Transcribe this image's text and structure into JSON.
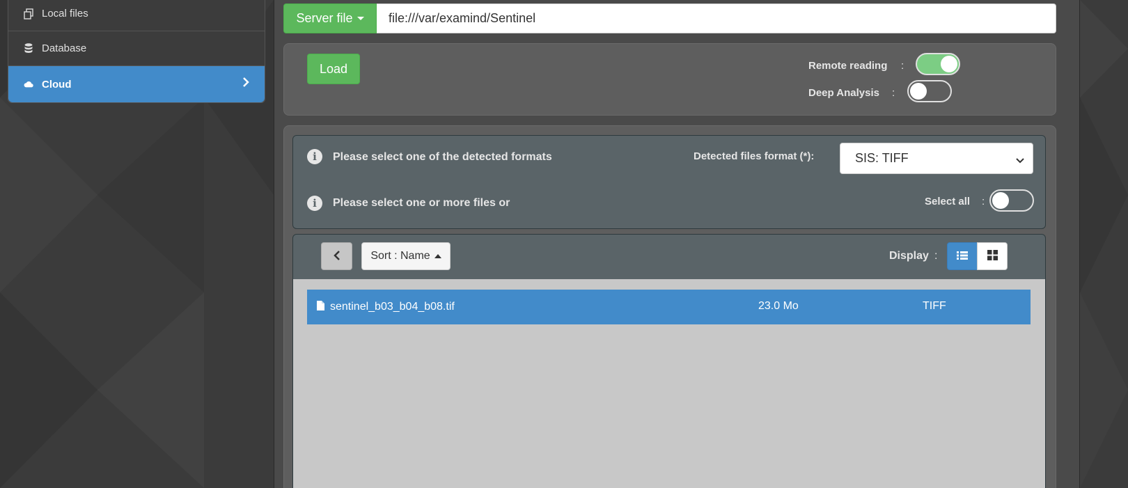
{
  "sidebar": {
    "items": [
      {
        "label": "Local files",
        "icon": "copy-icon"
      },
      {
        "label": "Database",
        "icon": "database-icon"
      },
      {
        "label": "Cloud",
        "icon": "cloud-icon",
        "active": true
      }
    ]
  },
  "source": {
    "type_button_label": "Server file",
    "url_value": "file:///var/examind/Sentinel"
  },
  "options": {
    "load_label": "Load",
    "remote_reading_label": "Remote reading",
    "remote_reading_on": true,
    "deep_analysis_label": "Deep Analysis",
    "deep_analysis_on": false,
    "colon": ":"
  },
  "info": {
    "formats_message": "Please select one of the detected formats",
    "files_message": "Please select one or more files or",
    "format_label": "Detected files format (*):",
    "format_selected": "SIS: TIFF",
    "select_all_label": "Select all",
    "select_all_on": false
  },
  "browser": {
    "sort_label": "Sort : Name",
    "display_label": "Display",
    "files": [
      {
        "name": "sentinel_b03_b04_b08.tif",
        "size": "23.0 Mo",
        "format": "TIFF",
        "selected": true
      }
    ]
  },
  "colors": {
    "accent": "#428bca",
    "success": "#5cb85c",
    "toggle_on": "#7ccd84"
  }
}
